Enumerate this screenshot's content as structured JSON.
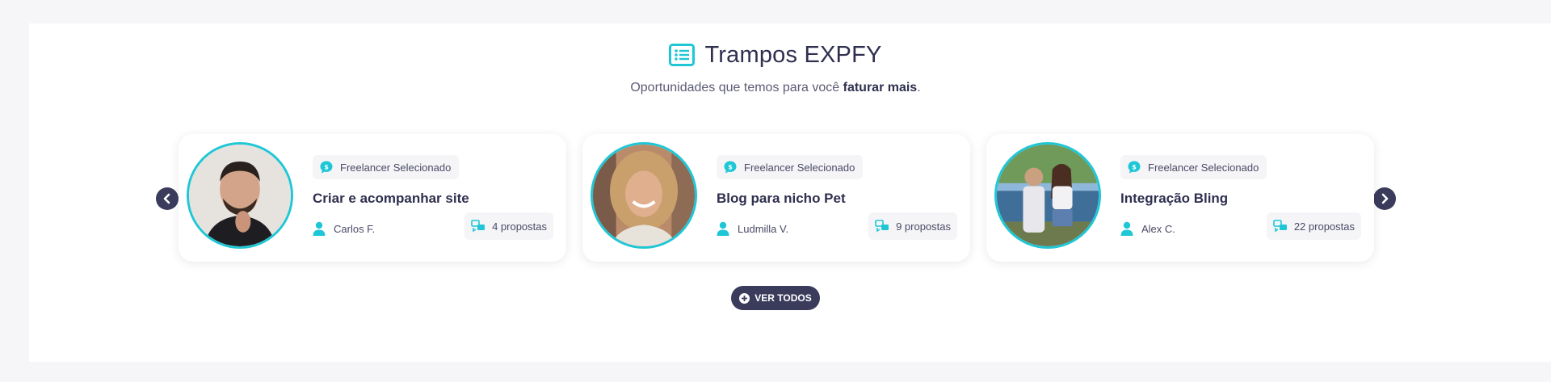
{
  "section": {
    "title": "Trampos EXPFY",
    "subtitle_prefix": "Oportunidades que temos para você ",
    "subtitle_bold": "faturar mais",
    "subtitle_suffix": "."
  },
  "cards": [
    {
      "badge": "Freelancer Selecionado",
      "title": "Criar e acompanhar site",
      "author": "Carlos F.",
      "proposals": "4 propostas"
    },
    {
      "badge": "Freelancer Selecionado",
      "title": "Blog para nicho Pet",
      "author": "Ludmilla V.",
      "proposals": "9 propostas"
    },
    {
      "badge": "Freelancer Selecionado",
      "title": "Integração Bling",
      "author": "Alex C.",
      "proposals": "22 propostas"
    }
  ],
  "buttons": {
    "ver_todos": "VER TODOS"
  },
  "colors": {
    "accent": "#1fc7d6",
    "dark": "#3b3b5c",
    "background": "#f6f6f9"
  },
  "icons": {
    "title": "list-icon",
    "badge": "chat-icon",
    "author": "user-icon",
    "proposals": "proposals-icon",
    "prev": "chevron-left-icon",
    "next": "chevron-right-icon",
    "ver_todos": "plus-circle-icon"
  }
}
